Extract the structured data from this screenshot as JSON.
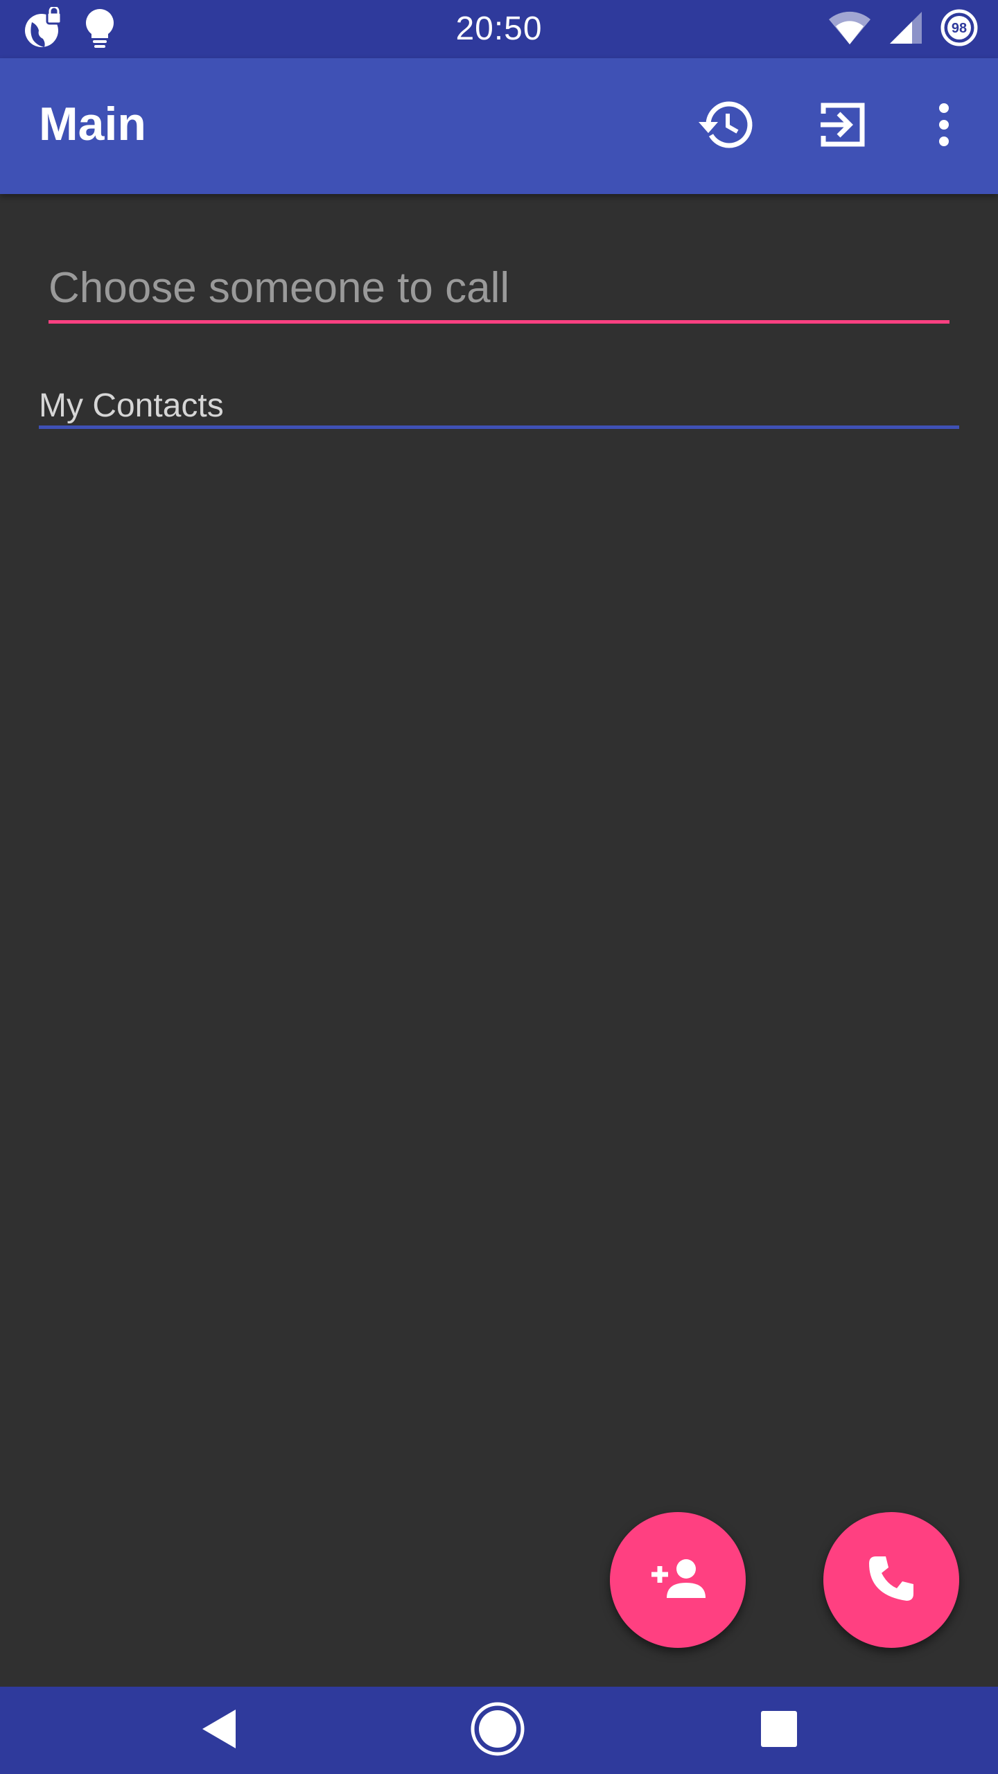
{
  "status_bar": {
    "time": "20:50",
    "battery_level": "98",
    "icons": [
      "vpn-globe-icon",
      "lightbulb-icon",
      "wifi-icon",
      "cell-signal-icon",
      "battery-icon"
    ]
  },
  "app_bar": {
    "title": "Main",
    "actions": [
      "history-icon",
      "exit-to-app-icon",
      "more-vert-icon"
    ]
  },
  "search": {
    "placeholder": "Choose someone to call",
    "value": ""
  },
  "contacts_section": {
    "label": "My Contacts",
    "items": []
  },
  "fabs": {
    "add_contact": "person-add-icon",
    "call": "phone-icon"
  },
  "nav_bar": {
    "buttons": [
      "back-icon",
      "home-icon",
      "recents-icon"
    ]
  },
  "colors": {
    "primary": "#3f51b5",
    "primary_dark": "#2f3a9c",
    "accent": "#ff4081",
    "background": "#303030"
  }
}
